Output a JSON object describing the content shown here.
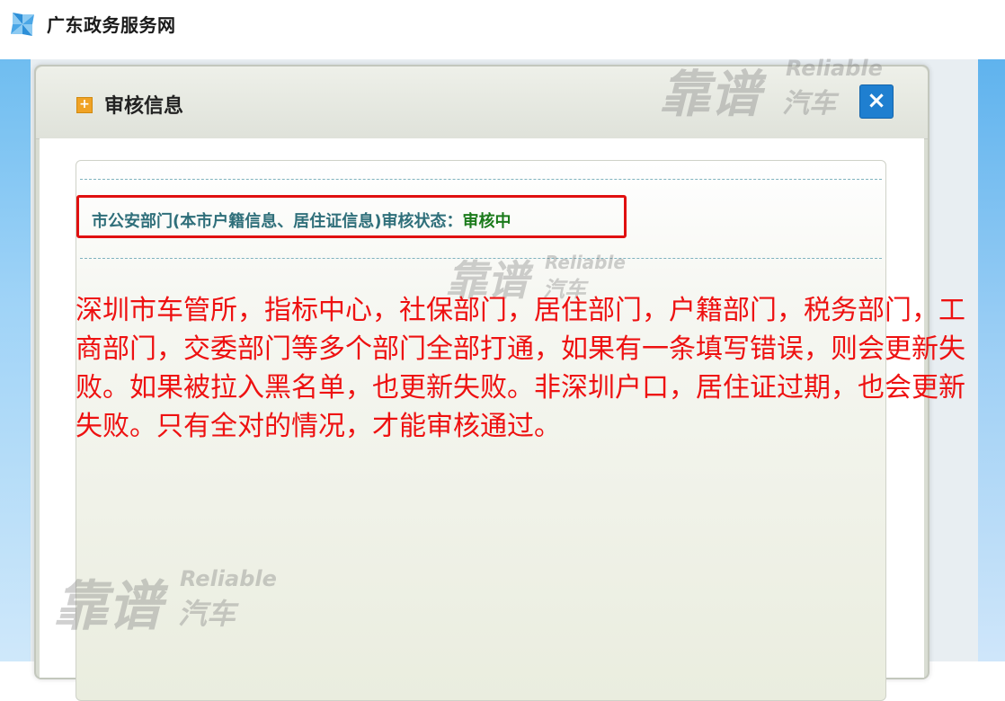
{
  "header": {
    "site_title": "广东政务服务网",
    "logo_icon": "pinwheel-logo-icon"
  },
  "dialog": {
    "title": "审核信息",
    "title_icon": "plus-square-icon",
    "close_label": "×",
    "close_icon": "close-icon",
    "status_label": "市公安部门(本市户籍信息、居住证信息)审核状态：",
    "status_value": "审核中"
  },
  "annotation": {
    "text": "深圳市车管所，指标中心，社保部门，居住部门，户籍部门，税务部门，工商部门，交委部门等多个部门全部打通，如果有一条填写错误，则会更新失败。如果被拉入黑名单，也更新失败。非深圳户口，居住证过期，也会更新失败。只有全对的情况，才能审核通过。"
  },
  "watermark": {
    "cn": "靠谱",
    "en": "Reliable",
    "cn2": "汽车"
  },
  "colors": {
    "status_label": "#2f6f7a",
    "status_value": "#1a7a1a",
    "annotation_text": "#ee1111",
    "highlight_border": "#e01010",
    "close_button": "#1f7fd0"
  }
}
